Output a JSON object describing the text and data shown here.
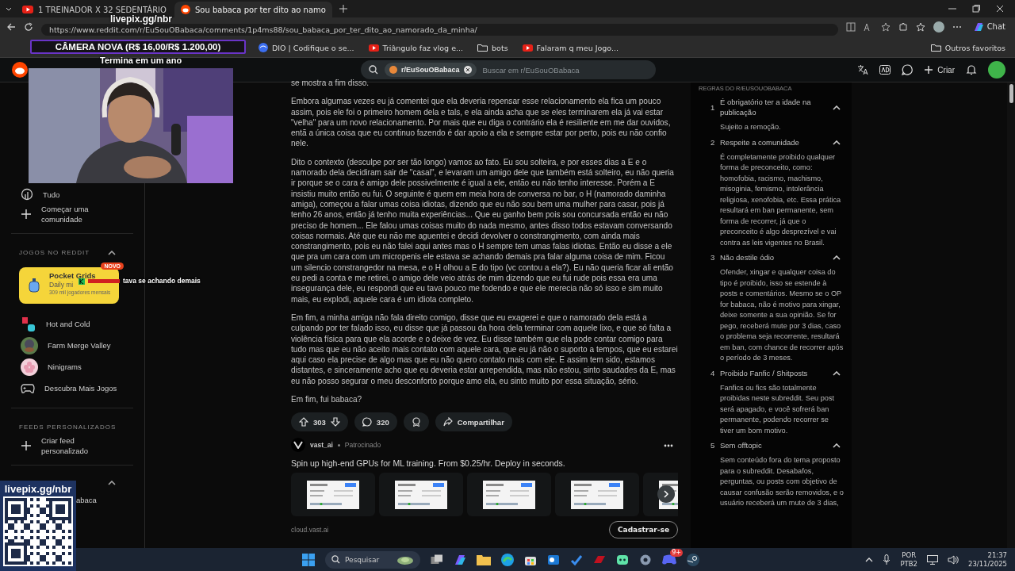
{
  "browser": {
    "tabs": [
      {
        "title": "1 TREINADOR X 32 SEDENTÁRIO",
        "kind": "video",
        "selected": false
      },
      {
        "title": "Sou babaca por ter dito ao namo",
        "kind": "forum",
        "selected": true
      }
    ],
    "url": "https://www.reddit.com/r/EuSouOBabaca/comments/1p4ms88/sou_babaca_por_ter_dito_ao_namorado_da_minha/",
    "chat_button": "Chat",
    "bookmarks": [
      {
        "label": "DIO | Codifique o se...",
        "kind": "site"
      },
      {
        "label": "Triângulo faz vlog e...",
        "kind": "video"
      },
      {
        "label": "bots",
        "kind": "folder"
      },
      {
        "label": "Falaram q meu Jogo...",
        "kind": "video"
      }
    ],
    "other_bookmarks": "Outros favoritos"
  },
  "reddit_header": {
    "community_chip": "r/EuSouOBabaca",
    "search_placeholder": "Buscar em r/EuSouOBabaca",
    "create_label": "Criar"
  },
  "left_nav": {
    "items": [
      {
        "label": "Tudo",
        "kind": "all"
      },
      {
        "label": "Começar uma comunidade",
        "kind": "add"
      }
    ],
    "games_heading": "JOGOS NO REDDIT",
    "featured_game": {
      "title": "Pocket Grids",
      "description": "Daily mi",
      "players": "309 mil jogadores mensais",
      "badge": "NOVO"
    },
    "games": [
      {
        "label": "Hot and Cold",
        "kind": "hc"
      },
      {
        "label": "Farm Merge Valley",
        "kind": "farm"
      },
      {
        "label": "Ninigrams",
        "kind": "flower"
      },
      {
        "label": "Descubra Mais Jogos",
        "kind": "controller"
      }
    ],
    "feeds_heading": "FEEDS PERSONALIZADOS",
    "feed_items": [
      {
        "label": "Criar feed personalizado"
      }
    ],
    "community_items": [
      {
        "label": "abaca"
      }
    ]
  },
  "post": {
    "paragraphs": [
      "se mostra a fim disso.",
      "Embora algumas vezes eu já comentei que ela deveria repensar esse relacionamento ela fica um pouco assim, pois ele foi o primeiro homem dela e tals, e ela ainda acha que se eles terminarem ela já vai estar \"velha\" para um novo relacionamento. Por mais que eu diga o contrário ela é resiliente em me dar ouvidos, entã a única coisa que eu continuo fazendo é dar apoio a ela e sempre estar por perto, pois eu não confio nele.",
      "Dito o contexto (desculpe por ser tão longo) vamos ao fato. Eu sou solteira, e por esses dias a E e o namorado dela decidiram sair de \"casal\", e levaram um amigo dele que também está solteiro, eu não queria ir porque se o cara é amigo dele possivelmente é igual a ele, então eu não tenho interesse. Porém a E insistiu muito então eu fui. O seguinte é quem em meia hora de conversa no bar, o H (namorado daminha amiga), começou a falar umas coisa idiotas, dizendo que eu não sou bem uma mulher para casar, pois já tenho 26 anos, então já tenho muita experiências... Que eu ganho bem pois sou concursada então eu não preciso de homem... Ele falou umas coisas muito do nada mesmo, antes disso todos estavam conversando coisas normais. Até que eu não me aguentei e decidi devolver o constrangimento, com ainda mais constrangimento, pois eu não falei aqui antes mas o H sempre tem umas falas idiotas. Então eu disse a ele que pra um cara com um micropenis ele estava se achando demais pra falar alguma coisa de mim. Ficou um silencio constrangedor na mesa, e o H olhou a E do tipo (vc contou a ela?). Eu não queria ficar ali então eu pedi a conta e me retirei, o amigo dele veio atrás de mim dizendo que eu fui rude pois essa era uma insegurança dele, eu respondi que eu tava pouco me fodendo e que ele merecia não só isso e sim muito mais, eu explodi, aquele cara é um idiota completo.",
      "Em fim, a minha amiga não fala direito comigo, disse que eu exagerei e que o namorado dela está a culpando por ter falado isso, eu disse que já passou da hora dela terminar com aquele lixo, e que só falta a violência física para que ela acorde e o deixe de vez. Eu disse também que ela pode contar comigo para tudo mas que eu não aceito mais contato com aquele cara, que eu já não o suporto a tempos, que eu estarei aqui caso ela precise de algo mas que eu não quero contato mais com ele. E assim tem sido, estamos distantes, e sinceramente acho que eu deveria estar arrependida, mas não estou, sinto saudades da E, mas eu não posso segurar o meu desconforto porque amo ela, eu sinto muito por essa situação, sério.",
      "Em fim, fui babaca?"
    ],
    "votes": "303",
    "comments": "320",
    "share": "Compartilhar"
  },
  "ad": {
    "advertiser": "vast_ai",
    "sponsored": "Patrocinado",
    "headline": "Spin up high-end GPUs for ML training. From $0.25/hr. Deploy in seconds.",
    "domain": "cloud.vast.ai",
    "cta": "Cadastrar-se"
  },
  "rules": {
    "heading": "REGRAS DO R/EUSOUOBABACA",
    "items": [
      {
        "number": "1",
        "title": "É obrigatório ter a idade na publicação",
        "description": "Sujeito a remoção.",
        "expanded": true
      },
      {
        "number": "2",
        "title": "Respeite a comunidade",
        "description": "É completamente proibido qualquer forma de preconceito, como: homofobia, racismo, machismo, misoginia, femismo, intolerância religiosa, xenofobia, etc. Essa prática resultará em ban permanente, sem forma de recorrer, já que o preconceito é algo desprezível e vai contra as leis vigentes no Brasil.",
        "expanded": true
      },
      {
        "number": "3",
        "title": "Não destile ódio",
        "description": "Ofender, xingar e qualquer coisa do tipo é proibido, isso se estende à posts e comentários. Mesmo se o OP for babaca, não é motivo para xingar, deixe somente a sua opinião. Se for pego, receberá mute por 3 dias, caso o problema seja recorrente, resultará em ban, com chance de recorrer após o período de 3 meses.",
        "expanded": true
      },
      {
        "number": "4",
        "title": "Proibido Fanfic / Shitposts",
        "description": "Fanfics ou fics são totalmente proibidas neste subreddit. Seu post será apagado, e você sofrerá ban permanente, podendo recorrer se tiver um bom motivo.",
        "expanded": true
      },
      {
        "number": "5",
        "title": "Sem offtopic",
        "description": "Sem conteúdo fora do tema proposto para o subreddit. Desabafos, perguntas, ou posts com objetivo de causar confusão serão removidos, e o usuário receberá um mute de 3 dias,",
        "expanded": true
      }
    ]
  },
  "taskbar": {
    "search_placeholder": "Pesquisar",
    "discord_badge": "9+",
    "language": "POR",
    "layout": "PTB2",
    "time": "21:37",
    "date": "23/11/2025"
  },
  "stream_overlay": {
    "donation_link": "livepix.gg/nbr",
    "goal": "CÂMERA NOVA (R$ 16,00/R$ 1.200,00)",
    "goal_ends": "Termina em um ano",
    "qr_label": "livepix.gg/nbr",
    "chat_message": "tava se achando demais"
  }
}
